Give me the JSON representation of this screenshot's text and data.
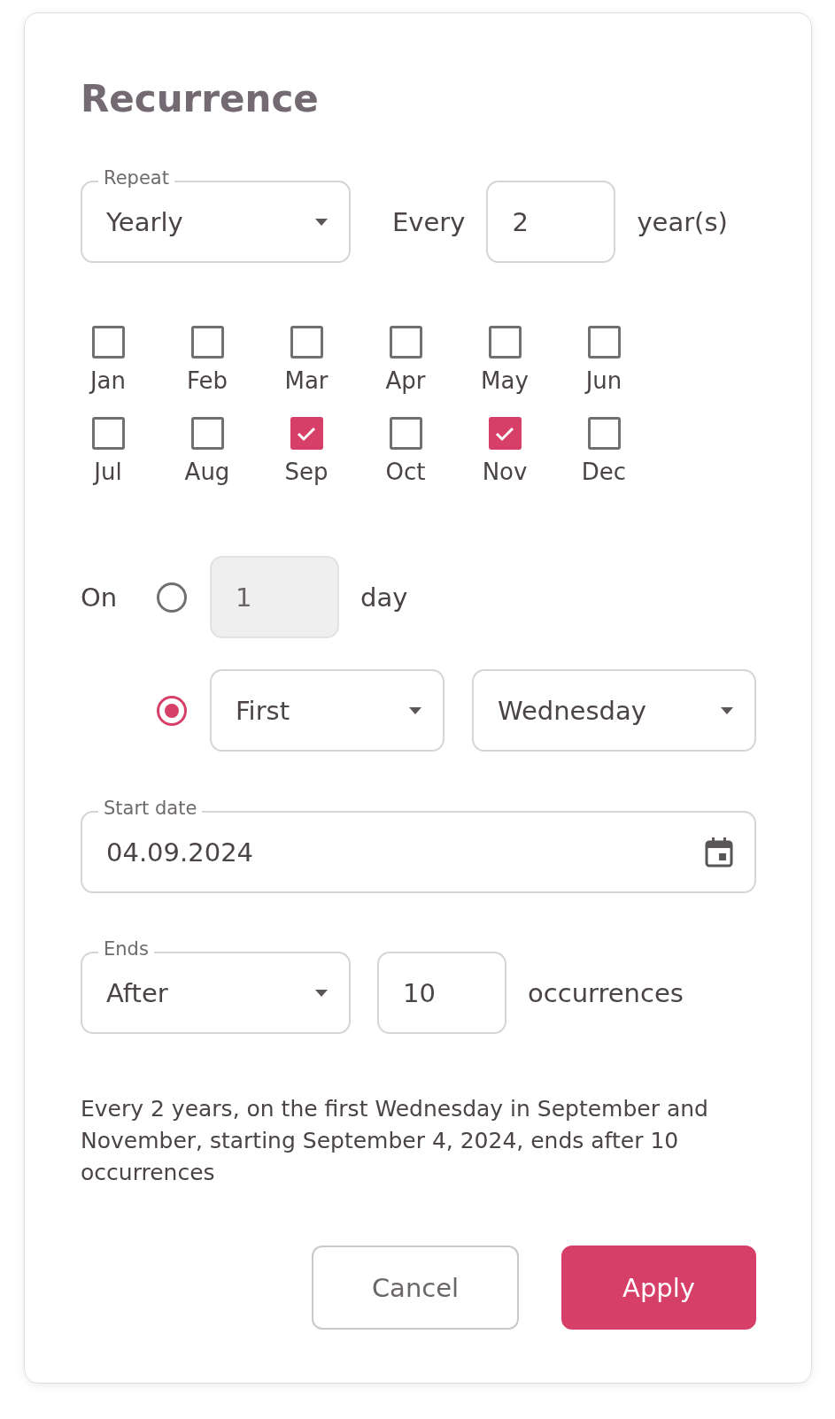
{
  "title": "Recurrence",
  "repeat": {
    "label": "Repeat",
    "value": "Yearly"
  },
  "every": {
    "label": "Every",
    "value": "2",
    "unit": "year(s)"
  },
  "months": [
    {
      "label": "Jan",
      "checked": false
    },
    {
      "label": "Feb",
      "checked": false
    },
    {
      "label": "Mar",
      "checked": false
    },
    {
      "label": "Apr",
      "checked": false
    },
    {
      "label": "May",
      "checked": false
    },
    {
      "label": "Jun",
      "checked": false
    },
    {
      "label": "Jul",
      "checked": false
    },
    {
      "label": "Aug",
      "checked": false
    },
    {
      "label": "Sep",
      "checked": true
    },
    {
      "label": "Oct",
      "checked": false
    },
    {
      "label": "Nov",
      "checked": true
    },
    {
      "label": "Dec",
      "checked": false
    }
  ],
  "on": {
    "label": "On",
    "options": [
      {
        "kind": "day",
        "selected": false,
        "disabled": true,
        "value": "1",
        "unit": "day"
      },
      {
        "kind": "weekday",
        "selected": true,
        "ordinal": "First",
        "weekday": "Wednesday"
      }
    ]
  },
  "start_date": {
    "label": "Start date",
    "value": "04.09.2024"
  },
  "ends": {
    "label": "Ends",
    "value": "After",
    "count": "10",
    "unit": "occurrences"
  },
  "summary": "Every 2 years, on the first Wednesday in September and November, starting September 4, 2024, ends after 10 occurrences",
  "buttons": [
    {
      "label": "Cancel",
      "kind": "secondary"
    },
    {
      "label": "Apply",
      "kind": "primary"
    }
  ]
}
